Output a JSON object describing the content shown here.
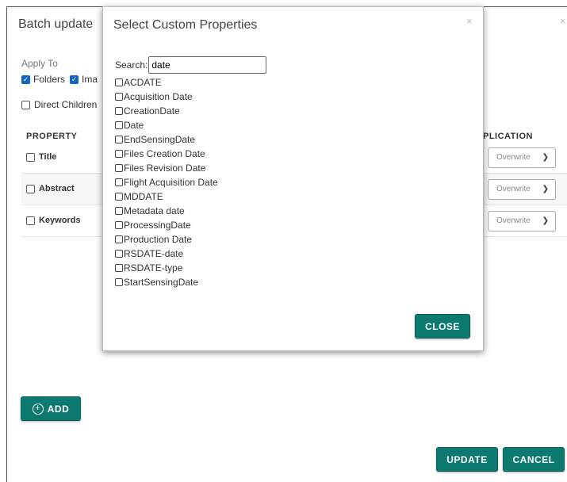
{
  "batch": {
    "title": "Batch update",
    "apply_to_label": "Apply To",
    "folders_label": "Folders",
    "images_label": "Ima",
    "direct_children_label": "Direct Children",
    "property_header": "PROPERTY",
    "application_header": "PLICATION",
    "rows": [
      {
        "label": "Title",
        "mode": "Overwrite"
      },
      {
        "label": "Abstract",
        "mode": "Overwrite"
      },
      {
        "label": "Keywords",
        "mode": "Overwrite"
      }
    ],
    "add_label": "ADD",
    "update_label": "UPDATE",
    "cancel_label": "CANCEL",
    "close_glyph": "×"
  },
  "modal": {
    "title": "Select Custom Properties",
    "close_glyph": "×",
    "search_label": "Search:",
    "search_value": "date",
    "options": [
      "ACDATE",
      "Acquisition Date",
      "CreationDate",
      "Date",
      "EndSensingDate",
      "Files Creation Date",
      "Files Revision Date",
      "Flight Acquisition Date",
      "MDDATE",
      "Metadata date",
      "ProcessingDate",
      "Production Date",
      "RSDATE-date",
      "RSDATE-type",
      "StartSensingDate"
    ],
    "close_button_label": "CLOSE"
  },
  "colors": {
    "accent": "#0d7a70",
    "checkbox_blue": "#1565c0"
  }
}
